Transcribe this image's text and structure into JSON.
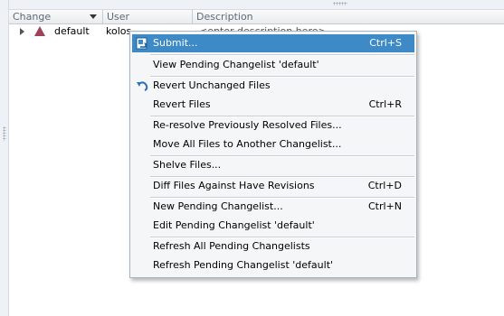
{
  "columns": {
    "change": "Change",
    "user": "User",
    "description": "Description"
  },
  "row": {
    "change": "default",
    "user": "kolos",
    "description": "<enter description here>"
  },
  "menu": {
    "items": [
      {
        "label": "Submit...",
        "shortcut": "Ctrl+S",
        "icon": "submit-icon",
        "highlighted": true
      },
      {
        "label": "View Pending Changelist 'default'",
        "shortcut": ""
      },
      {
        "label": "Revert Unchanged Files",
        "shortcut": "",
        "icon": "revert-icon"
      },
      {
        "label": "Revert Files",
        "shortcut": "Ctrl+R"
      },
      {
        "label": "Re-resolve Previously Resolved Files...",
        "shortcut": ""
      },
      {
        "label": "Move All Files to Another Changelist...",
        "shortcut": ""
      },
      {
        "label": "Shelve Files...",
        "shortcut": ""
      },
      {
        "label": "Diff Files Against Have Revisions",
        "shortcut": "Ctrl+D"
      },
      {
        "label": "New Pending Changelist...",
        "shortcut": "Ctrl+N"
      },
      {
        "label": "Edit Pending Changelist 'default'",
        "shortcut": ""
      },
      {
        "label": "Refresh All Pending Changelists",
        "shortcut": ""
      },
      {
        "label": "Refresh Pending Changelist 'default'",
        "shortcut": ""
      }
    ]
  },
  "colors": {
    "highlight": "#3d8ac7",
    "changelist_icon": "#a0405a",
    "revert_icon": "#2c6fb4"
  }
}
